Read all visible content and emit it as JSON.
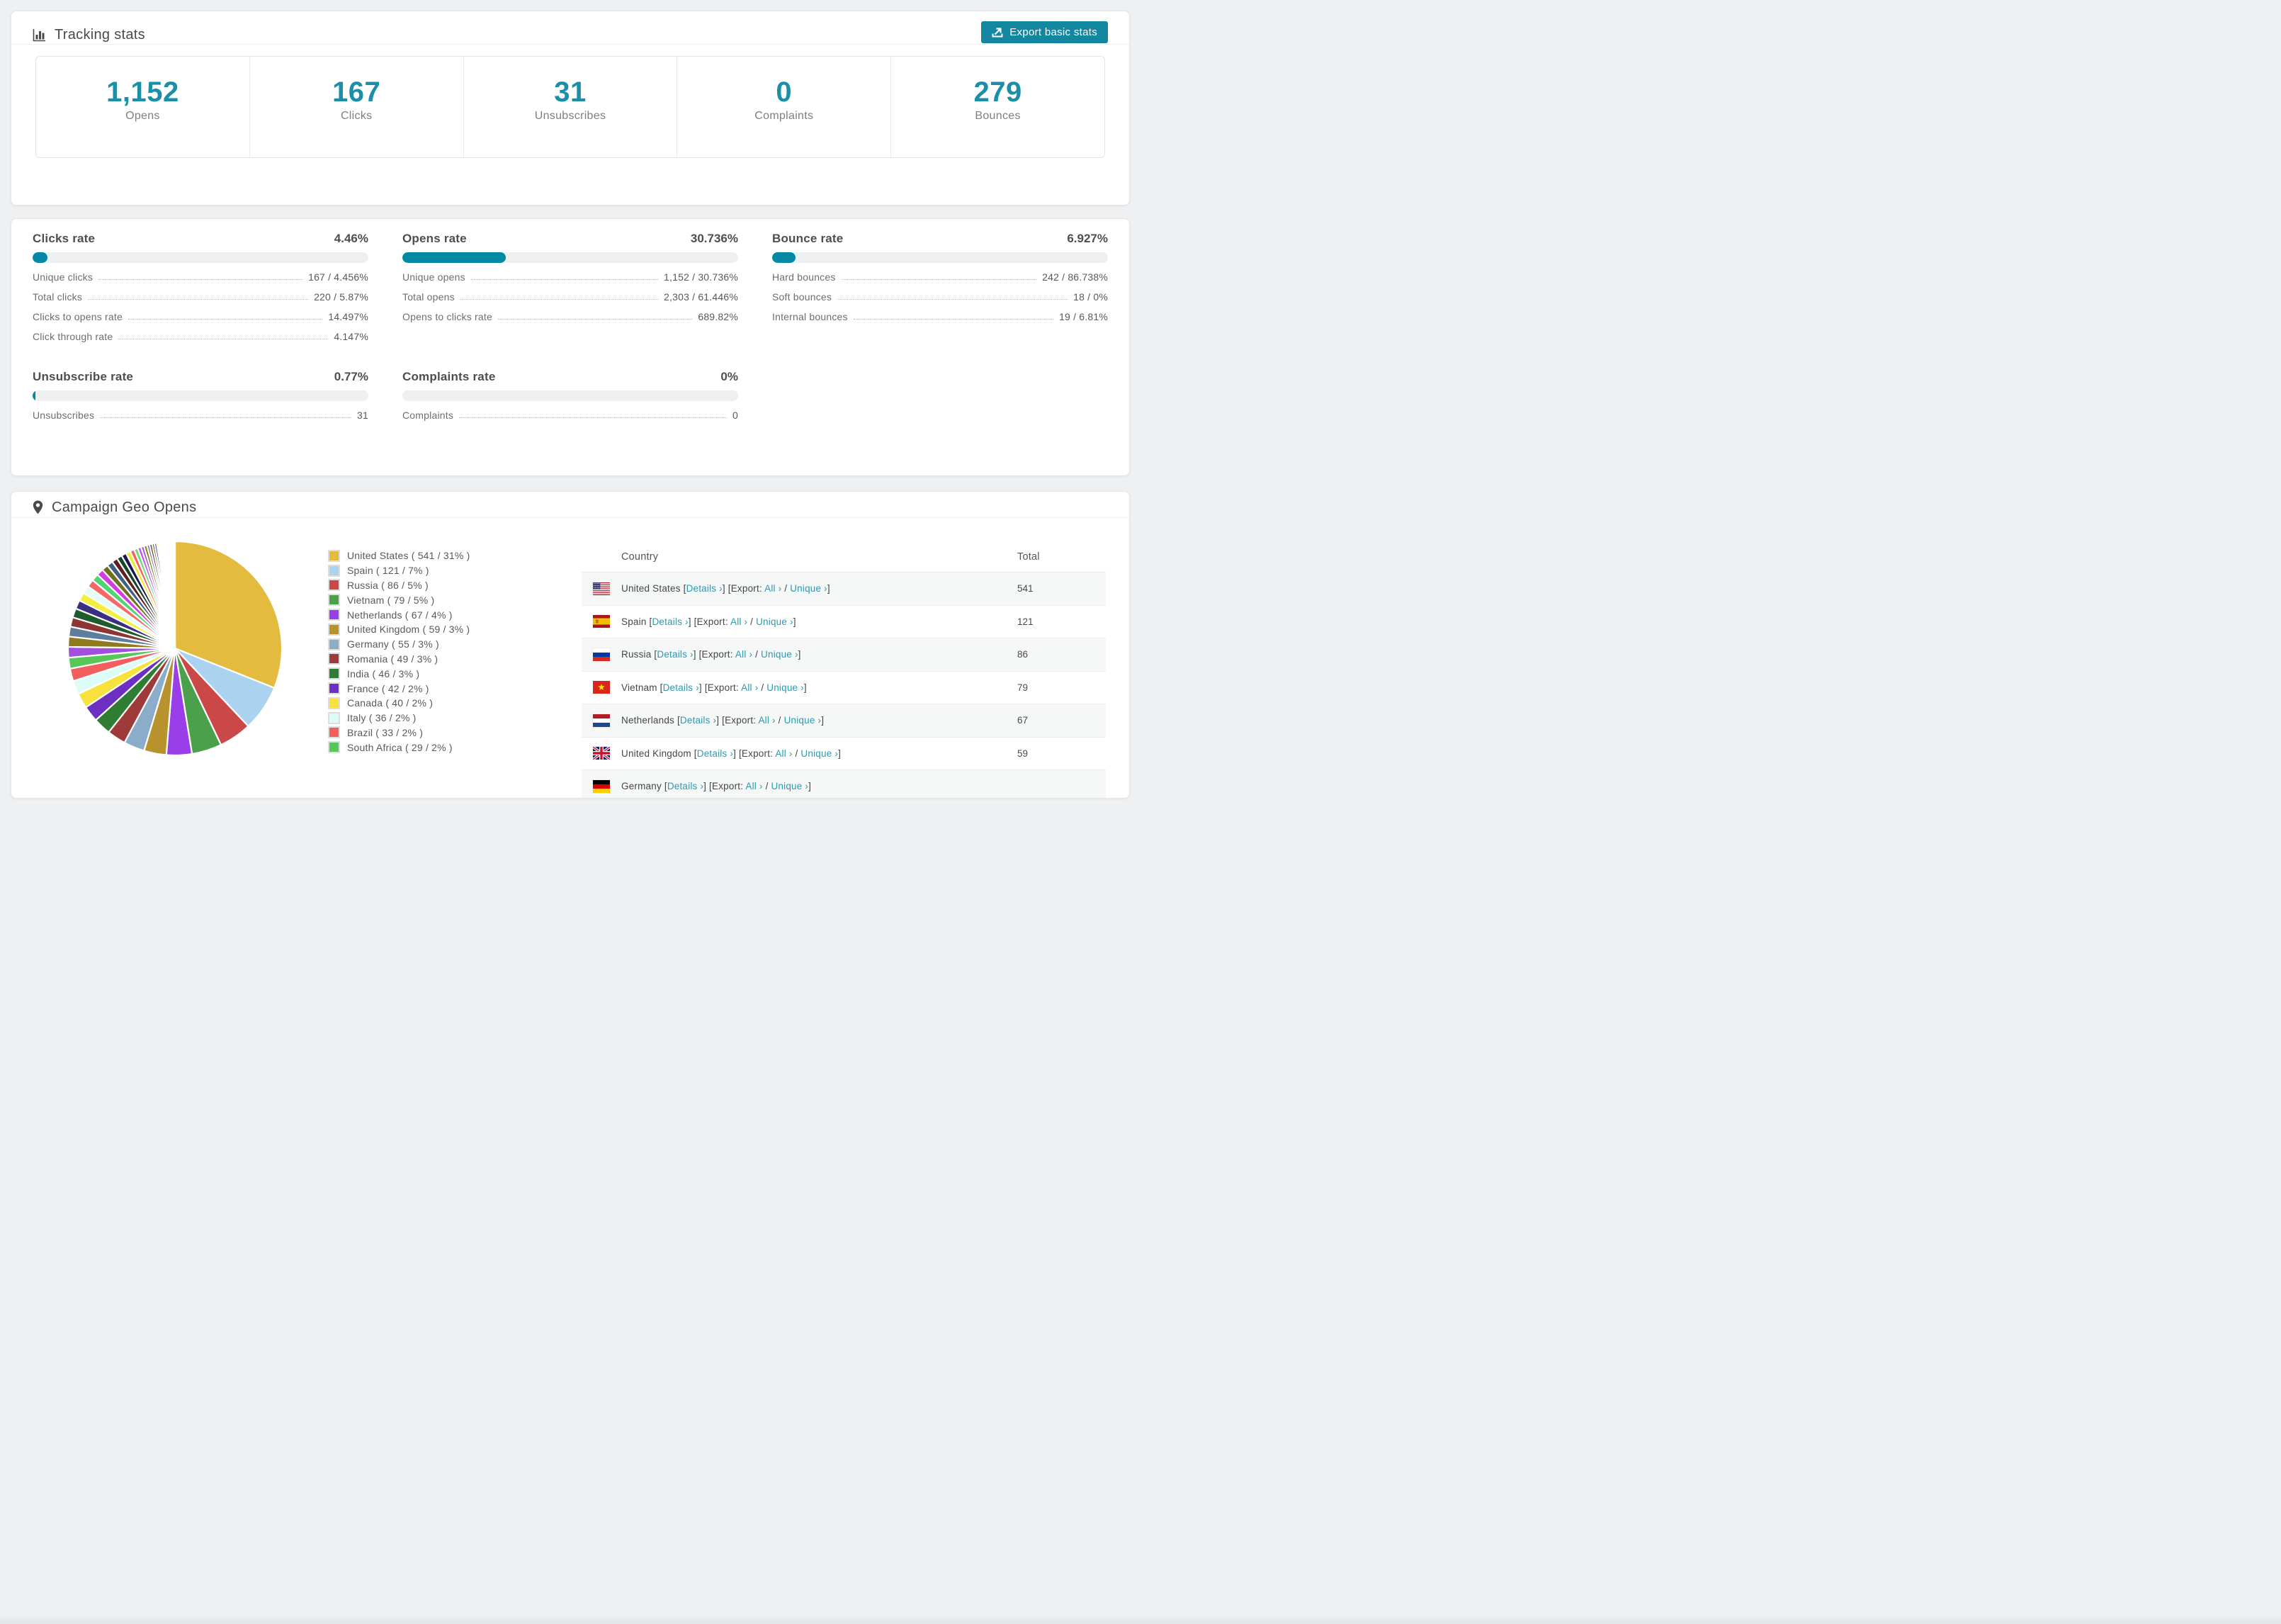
{
  "colors": {
    "accent_button": "#1386a0",
    "progress_fill": "#0389a3",
    "big_number": "#1b8fa8",
    "link": "#2a9ab5",
    "table_stripe": "#f6f7f7"
  },
  "tracking_card": {
    "title": "Tracking stats",
    "icon": "bar-chart-icon",
    "export_button": {
      "label": "Export basic stats",
      "icon": "export-icon"
    },
    "stats": [
      {
        "value": "1,152",
        "label": "Opens"
      },
      {
        "value": "167",
        "label": "Clicks"
      },
      {
        "value": "31",
        "label": "Unsubscribes"
      },
      {
        "value": "0",
        "label": "Complaints"
      },
      {
        "value": "279",
        "label": "Bounces"
      }
    ]
  },
  "rates": [
    {
      "title": "Clicks rate",
      "value": "4.46%",
      "pct": 4.46,
      "rows": [
        [
          "Unique clicks",
          "167 / 4.456%"
        ],
        [
          "Total clicks",
          "220 / 5.87%"
        ],
        [
          "Clicks to opens rate",
          "14.497%"
        ],
        [
          "Click through rate",
          "4.147%"
        ]
      ]
    },
    {
      "title": "Opens rate",
      "value": "30.736%",
      "pct": 30.736,
      "rows": [
        [
          "Unique opens",
          "1,152 / 30.736%"
        ],
        [
          "Total opens",
          "2,303 / 61.446%"
        ],
        [
          "Opens to clicks rate",
          "689.82%"
        ]
      ]
    },
    {
      "title": "Bounce rate",
      "value": "6.927%",
      "pct": 6.927,
      "rows": [
        [
          "Hard bounces",
          "242 / 86.738%"
        ],
        [
          "Soft bounces",
          "18 / 0%"
        ],
        [
          "Internal bounces",
          "19 / 6.81%"
        ]
      ]
    },
    {
      "title": "Unsubscribe rate",
      "value": "0.77%",
      "pct": 0.77,
      "rows": [
        [
          "Unsubscribes",
          "31"
        ]
      ]
    },
    {
      "title": "Complaints rate",
      "value": "0%",
      "pct": 0,
      "rows": [
        [
          "Complaints",
          "0"
        ]
      ]
    }
  ],
  "geo": {
    "title": "Campaign Geo Opens",
    "icon": "map-pin-icon",
    "legend": [
      {
        "label": "United States ( 541 / 31% )",
        "color": "#e3bc3f"
      },
      {
        "label": "Spain ( 121 / 7% )",
        "color": "#abd3f0"
      },
      {
        "label": "Russia ( 86 / 5% )",
        "color": "#cb4848"
      },
      {
        "label": "Vietnam ( 79 / 5% )",
        "color": "#4ba14b"
      },
      {
        "label": "Netherlands ( 67 / 4% )",
        "color": "#993ee8"
      },
      {
        "label": "United Kingdom ( 59 / 3% )",
        "color": "#b8922d"
      },
      {
        "label": "Germany ( 55 / 3% )",
        "color": "#8badc9"
      },
      {
        "label": "Romania ( 49 / 3% )",
        "color": "#9e3a3a"
      },
      {
        "label": "India ( 46 / 3% )",
        "color": "#2f7d33"
      },
      {
        "label": "France ( 42 / 2% )",
        "color": "#6c2fc2"
      },
      {
        "label": "Canada ( 40 / 2% )",
        "color": "#f7e13d"
      },
      {
        "label": "Italy ( 36 / 2% )",
        "color": "#dcfcf7"
      },
      {
        "label": "Brazil ( 33 / 2% )",
        "color": "#f25e5e"
      },
      {
        "label": "South Africa ( 29 / 2% )",
        "color": "#55c858"
      }
    ],
    "table": {
      "headers": [
        "Country",
        "Total"
      ],
      "link_labels": {
        "details": "Details ›",
        "export": "[Export:",
        "all": "All ›",
        "slash": " / ",
        "unique": "Unique ›"
      },
      "rows": [
        {
          "country": "United States",
          "flag": "us",
          "total": "541"
        },
        {
          "country": "Spain",
          "flag": "es",
          "total": "121"
        },
        {
          "country": "Russia",
          "flag": "ru",
          "total": "86"
        },
        {
          "country": "Vietnam",
          "flag": "vn",
          "total": "79"
        },
        {
          "country": "Netherlands",
          "flag": "nl",
          "total": "67"
        },
        {
          "country": "United Kingdom",
          "flag": "gb",
          "total": "59"
        },
        {
          "country": "Germany",
          "flag": "de",
          "total": ""
        }
      ]
    }
  },
  "chart_data": {
    "type": "pie",
    "title": "Campaign Geo Opens",
    "legend_position": "right",
    "start_angle_deg": -90,
    "direction": "clockwise",
    "categories": [
      "United States",
      "Spain",
      "Russia",
      "Vietnam",
      "Netherlands",
      "United Kingdom",
      "Germany",
      "Romania",
      "India",
      "France",
      "Canada",
      "Italy",
      "Brazil",
      "South Africa"
    ],
    "values": [
      541,
      121,
      86,
      79,
      67,
      59,
      55,
      49,
      46,
      42,
      40,
      36,
      33,
      29
    ],
    "percents": [
      31,
      7,
      5,
      5,
      4,
      3,
      3,
      3,
      3,
      2,
      2,
      2,
      2,
      2
    ],
    "colors": [
      "#e3bc3f",
      "#abd3f0",
      "#cb4848",
      "#4ba14b",
      "#993ee8",
      "#b8922d",
      "#8badc9",
      "#9e3a3a",
      "#2f7d33",
      "#6c2fc2",
      "#f7e13d",
      "#dcfcf7",
      "#f25e5e",
      "#55c858"
    ],
    "others_estimated": {
      "note": "many small unlabeled countries forming the thin-slice fan",
      "values": [
        28,
        27,
        26,
        25,
        24,
        23,
        22,
        21,
        20,
        19,
        18,
        17,
        16,
        15,
        14,
        13,
        12,
        11,
        10,
        9,
        8,
        8,
        7,
        7,
        6,
        6,
        5,
        5,
        4,
        4,
        3,
        3,
        3,
        2,
        2,
        2,
        2,
        1,
        1,
        1,
        1,
        1,
        1,
        1,
        1,
        1,
        1,
        1,
        1,
        1
      ],
      "palette": [
        "#a24fe0",
        "#8f7a1e",
        "#5f7d9c",
        "#8b3535",
        "#1d5c2c",
        "#3a2f80",
        "#f3ef3d",
        "#e4fbf6",
        "#f56868",
        "#52d374",
        "#d23ce0",
        "#6f6f1c",
        "#3f5f83",
        "#5e1f1f",
        "#14452a",
        "#1c1650",
        "#ece93a",
        "#ff5c5c",
        "#66e07a",
        "#c055e8"
      ]
    }
  }
}
